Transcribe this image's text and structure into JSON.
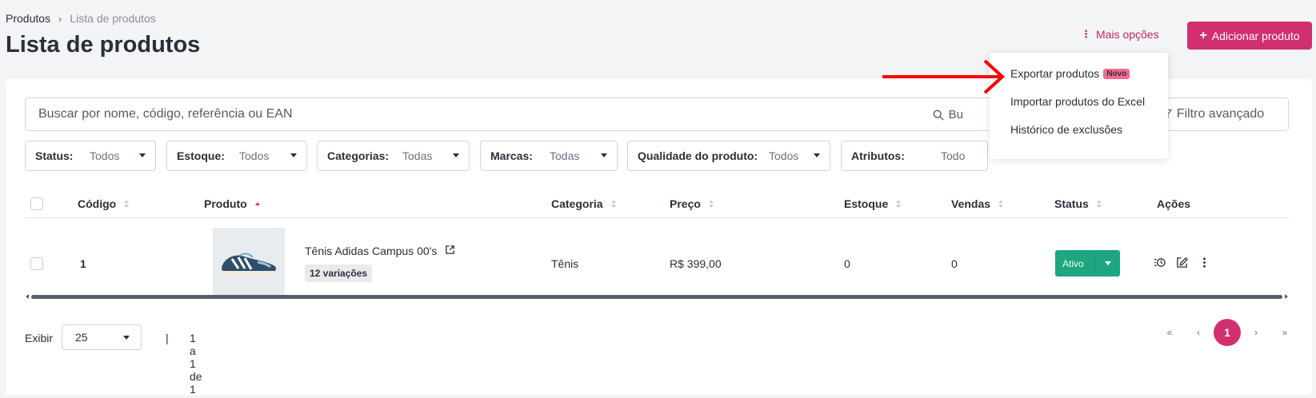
{
  "breadcrumb": {
    "root": "Produtos",
    "separator": "›",
    "current": "Lista de produtos"
  },
  "header": {
    "title": "Lista de produtos",
    "more_options": "Mais opções",
    "add_button": "Adicionar produto"
  },
  "dropdown_menu": {
    "items": [
      {
        "label": "Exportar produtos",
        "badge": "Novo"
      },
      {
        "label": "Importar produtos do Excel"
      },
      {
        "label": "Histórico de exclusões"
      }
    ]
  },
  "search": {
    "placeholder": "Buscar por nome, código, referência ou EAN",
    "button_label": "Bu",
    "advanced_filter": "Filtro avançado"
  },
  "filters": [
    {
      "label": "Status:",
      "value": "Todos"
    },
    {
      "label": "Estoque:",
      "value": "Todos"
    },
    {
      "label": "Categorias:",
      "value": "Todas"
    },
    {
      "label": "Marcas:",
      "value": "Todas"
    },
    {
      "label": "Qualidade do produto:",
      "value": "Todos"
    },
    {
      "label": "Atributos:",
      "value": "Todo"
    }
  ],
  "table": {
    "columns": [
      "Código",
      "Produto",
      "Categoria",
      "Preço",
      "Estoque",
      "Vendas",
      "Status",
      "Ações"
    ],
    "rows": [
      {
        "code": "1",
        "product": "Tênis Adidas Campus 00's",
        "variations": "12 variações",
        "category": "Tênis",
        "price": "R$ 399,00",
        "stock": "0",
        "sales": "0",
        "status": "Ativo"
      }
    ]
  },
  "footer": {
    "show_label": "Exibir",
    "page_size": "25",
    "separator": "|",
    "range": "1 a 1 de 1"
  },
  "pagination": {
    "first": "«",
    "prev": "‹",
    "current": "1",
    "next": "›",
    "last": "»"
  },
  "colors": {
    "brand": "#d22f6f",
    "status_active": "#1ea680",
    "annotation_arrow": "#ff0000"
  },
  "icons": [
    "dots-vertical-icon",
    "plus-icon",
    "search-icon",
    "filter-icon",
    "external-link-icon",
    "history-icon",
    "edit-icon",
    "more-vertical-icon"
  ]
}
